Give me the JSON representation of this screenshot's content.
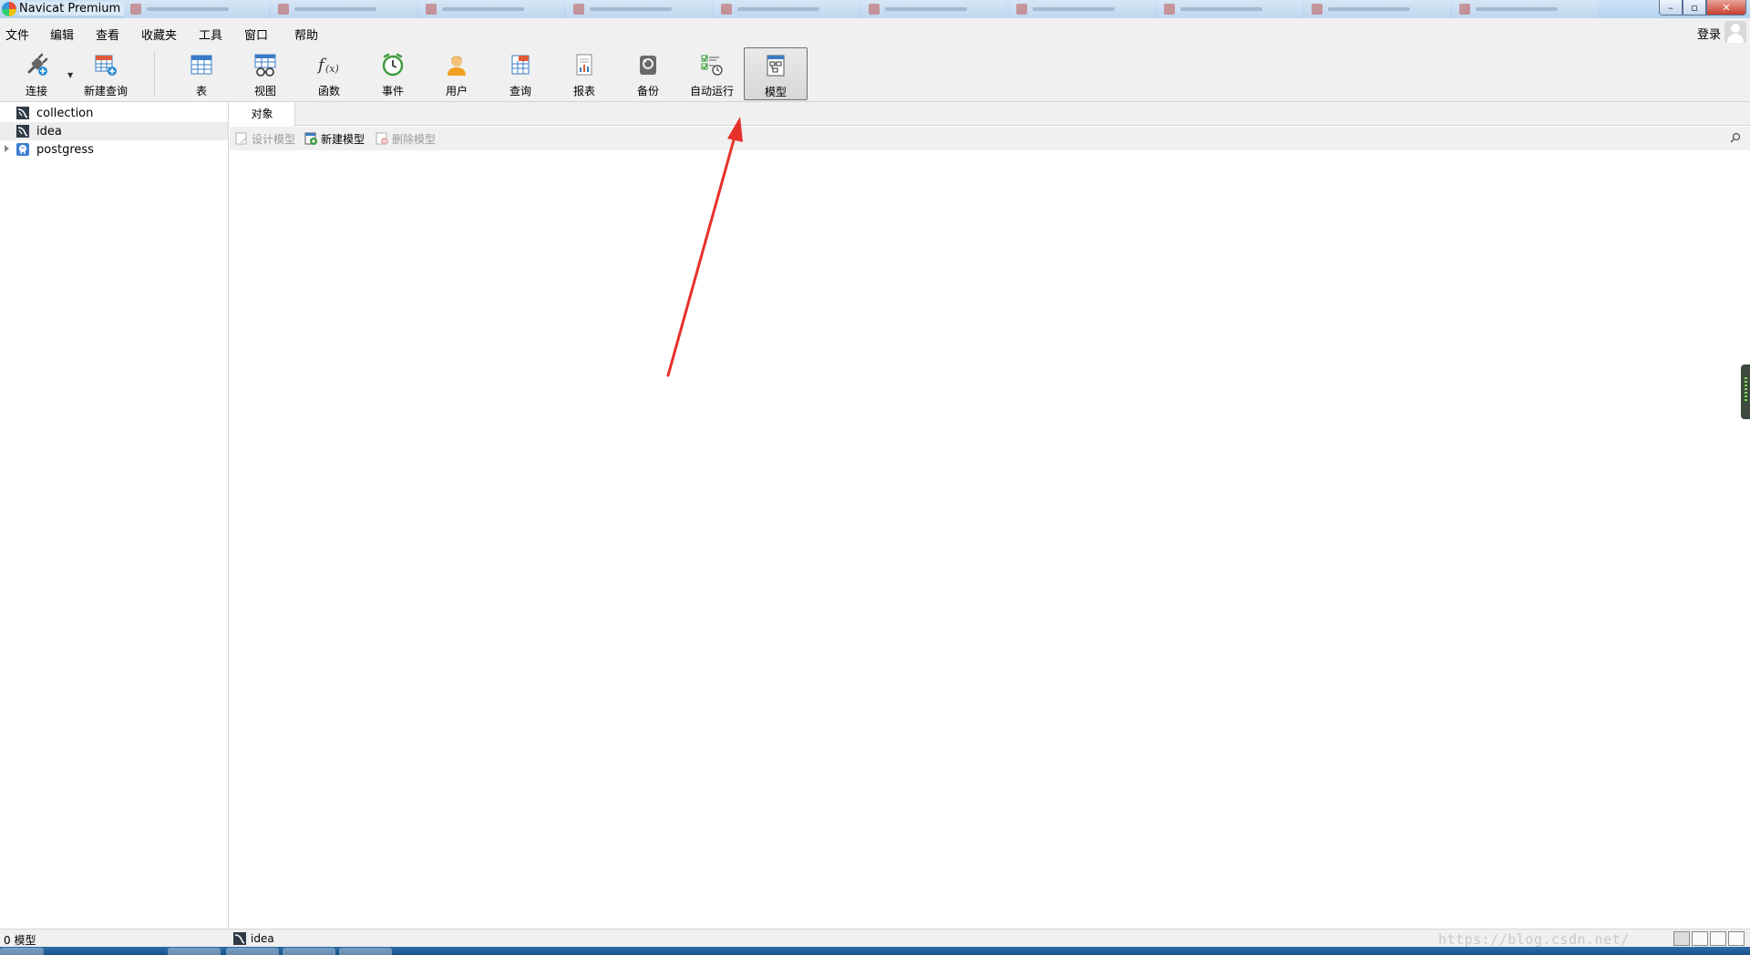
{
  "window": {
    "title": "Navicat Premium",
    "minimize_glyph": "–",
    "maximize_glyph": "▫",
    "close_glyph": "✕"
  },
  "menu": {
    "items": [
      "文件",
      "编辑",
      "查看",
      "收藏夹",
      "工具",
      "窗口",
      "帮助"
    ],
    "login": "登录"
  },
  "toolbar": {
    "connect": "连接",
    "new_query": "新建查询",
    "table": "表",
    "view": "视图",
    "function": "函数",
    "event": "事件",
    "user": "用户",
    "query": "查询",
    "report": "报表",
    "backup": "备份",
    "automation": "自动运行",
    "model": "模型",
    "active": "model"
  },
  "sidebar": {
    "connections": [
      {
        "name": "collection",
        "type": "mysql"
      },
      {
        "name": "idea",
        "type": "mysql",
        "selected": true
      },
      {
        "name": "postgress",
        "type": "postgresql",
        "collapsed": true
      }
    ]
  },
  "main": {
    "tab": "对象",
    "actions": {
      "design_model": "设计模型",
      "new_model": "新建模型",
      "delete_model": "删除模型"
    }
  },
  "status": {
    "count": "0 模型",
    "connection": "idea",
    "watermark": "https://blog.csdn.net/"
  },
  "colors": {
    "annotation_arrow": "#e8302a",
    "selection": "#ececec",
    "toolbar_bg": "#f0f0f0"
  }
}
